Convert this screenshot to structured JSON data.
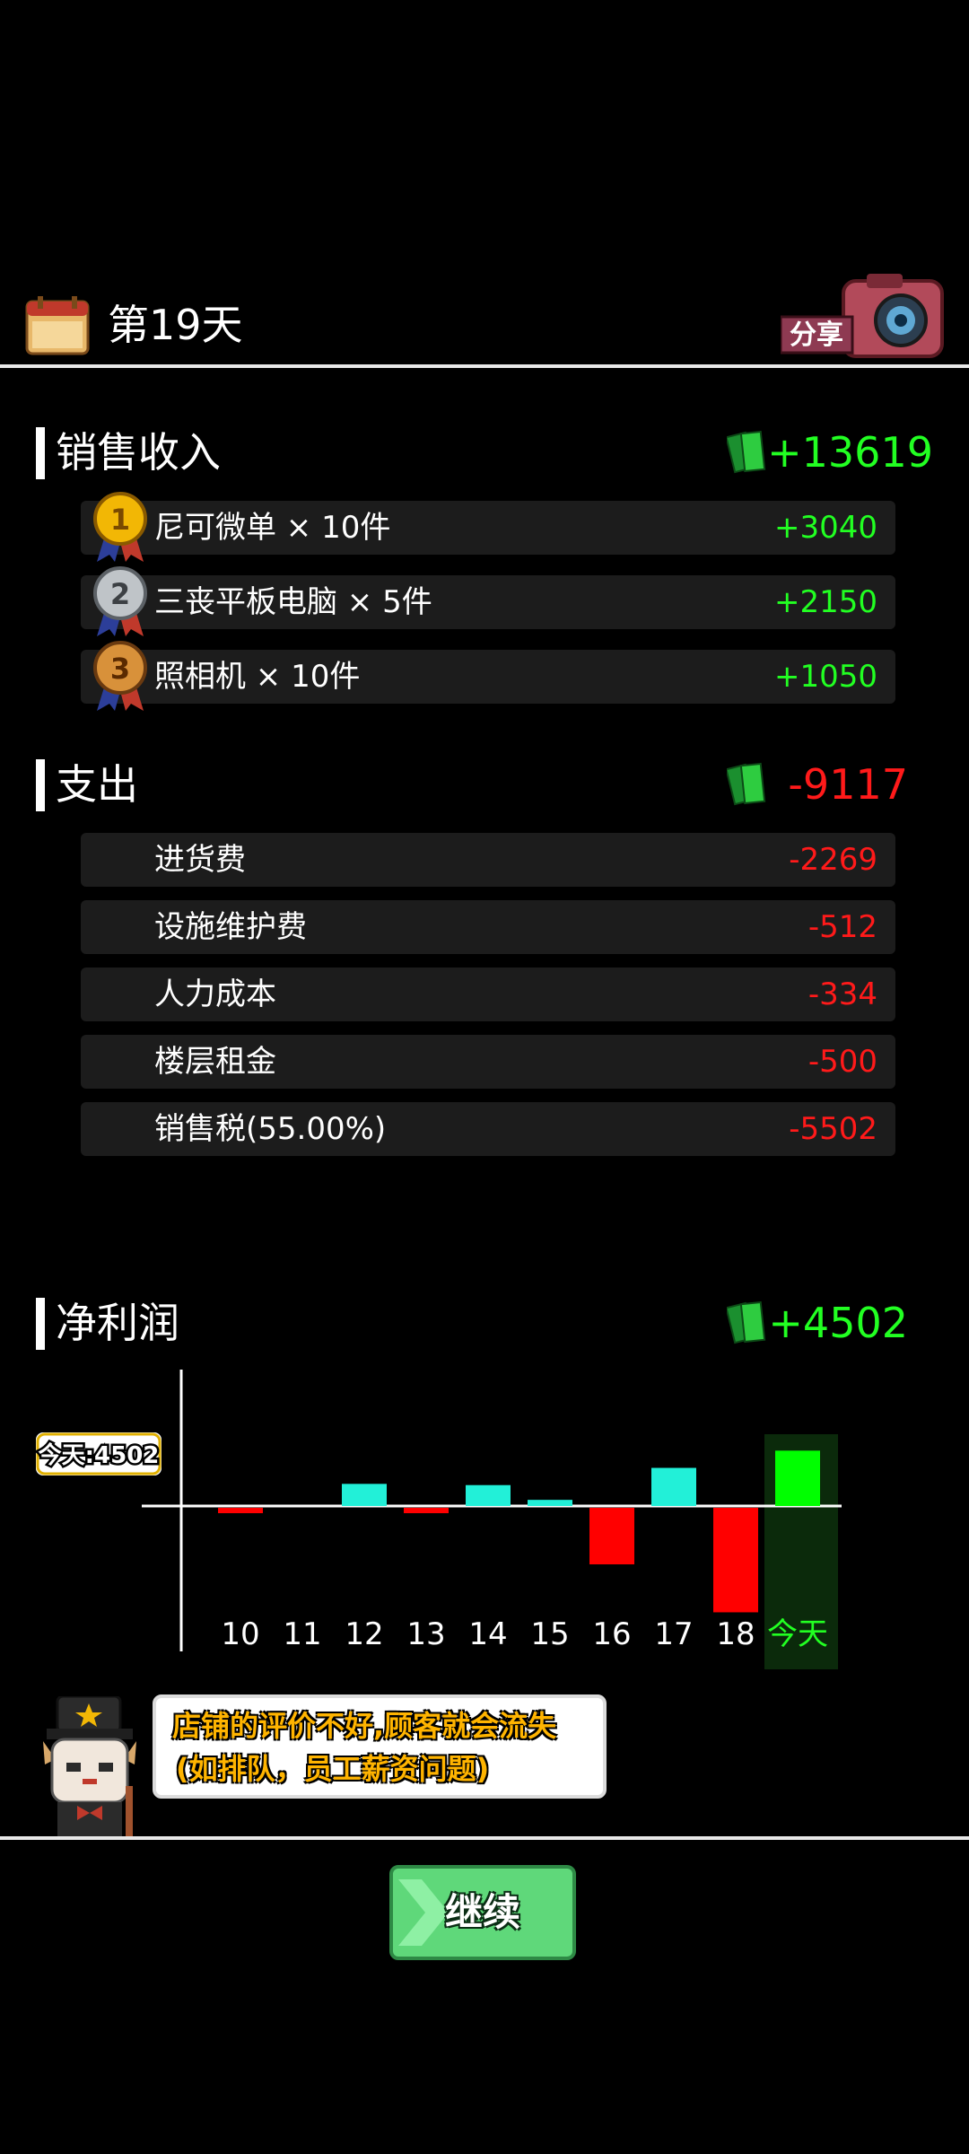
{
  "header": {
    "day_title": "第19天",
    "share_label": "分享"
  },
  "income": {
    "title": "销售收入",
    "total": "+13619",
    "items": [
      {
        "rank": "1",
        "label": "尼可微单 × 10件",
        "value": "+3040"
      },
      {
        "rank": "2",
        "label": "三丧平板电脑 × 5件",
        "value": "+2150"
      },
      {
        "rank": "3",
        "label": "照相机 × 10件",
        "value": "+1050"
      }
    ]
  },
  "expense": {
    "title": "支出",
    "total": "-9117",
    "items": [
      {
        "label": "进货费",
        "value": "-2269"
      },
      {
        "label": "设施维护费",
        "value": "-512"
      },
      {
        "label": "人力成本",
        "value": "-334"
      },
      {
        "label": "楼层租金",
        "value": "-500"
      },
      {
        "label": "销售税(55.00%)",
        "value": "-5502"
      }
    ]
  },
  "profit": {
    "title": "净利润",
    "total": "+4502",
    "today_badge": "今天:4502"
  },
  "chart_data": {
    "type": "bar",
    "categories": [
      "10",
      "11",
      "12",
      "13",
      "14",
      "15",
      "16",
      "17",
      "18",
      "今天"
    ],
    "values": [
      -300,
      0,
      1800,
      -300,
      1700,
      500,
      -4600,
      3100,
      -8500,
      4502
    ],
    "highlight_index": 9,
    "ylim": [
      -9000,
      5500
    ],
    "colors": {
      "positive": "#22f0d8",
      "negative": "#ff0000",
      "today": "#00ff00",
      "today_bg": "#0b2a0b",
      "today_label": "#22ff22"
    }
  },
  "tip": {
    "line1": "店铺的评价不好,顾客就会流失",
    "line2": "(如排队，员工薪资问题)"
  },
  "continue_label": "继续",
  "colors": {
    "positive": "#22ff22",
    "negative": "#ff1a1a",
    "button": "#5fd87a"
  }
}
